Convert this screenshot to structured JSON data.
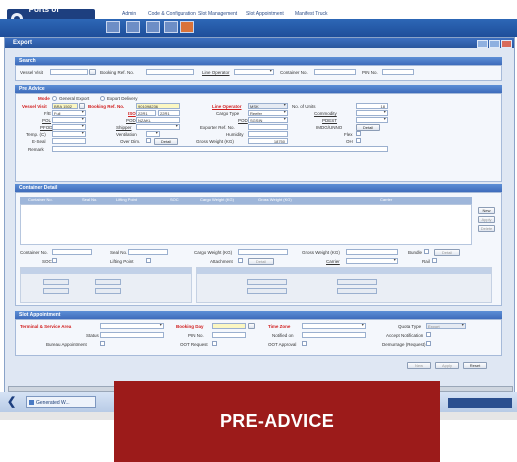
{
  "header": {
    "logo": "Ports of Auckland",
    "nav": [
      "Admin",
      "Code & Configuration",
      "Slot Management",
      "Slot Appointment",
      "Manifest Truck"
    ]
  },
  "window": {
    "title": "Export",
    "search": {
      "title": "Search",
      "vessel_visit": "Vessel Visit",
      "booking_ref": "Booking Ref. No.",
      "line_operator": "Line Operator",
      "container_no": "Container No.",
      "pin_no": "PIN No."
    },
    "preadvice": {
      "title": "Pre Advice",
      "mode_label": "Mode",
      "mode_general": "General Export",
      "mode_export_delivery": "Export Delivery",
      "vessel_visit_label": "Vessel Visit",
      "vessel_visit_value": "BRA 1502",
      "booking_label": "Booking Ref. No.",
      "booking_value": "901098236",
      "line_operator_label": "Line Operator",
      "line_operator_value": "MSK",
      "no_units_label": "No. of Units",
      "no_units_value": "18",
      "fe_label": "F/E",
      "fe_value": "Full",
      "iso_label": "ISO",
      "iso_value": "22R1",
      "iso_value2": "22R1",
      "cargo_type_label": "Cargo Type",
      "cargo_type_value": "Reefer",
      "commodity_label": "Commodity",
      "pol_label": "POL",
      "pol_value": "NZAKL",
      "pod_label": "POD",
      "pod_value": "SGSIN",
      "pod2_label": "PDEST",
      "pol2_label": "POD",
      "pfod_label": "PFOD",
      "shipper_label": "Shipper",
      "exporter_ref_label": "Exporter Ref. No.",
      "imdg_label": "IMDG/UNNO",
      "detail_btn": "Detail",
      "temp_label": "Temp. (C)",
      "ventilation_label": "Ventilation",
      "humidity_label": "Humidity",
      "flex_label": "Flex",
      "e_seal_label": "E-Seal",
      "over_dim_label": "Over Dim.",
      "gross_weight_label": "Gross Weight (KG)",
      "gross_weight_value": "18750",
      "oh_label": "OH",
      "remark_label": "Remark"
    },
    "container_detail": {
      "title": "Container Detail",
      "columns": [
        "Container No.",
        "Seal No.",
        "Lifting Point",
        "SOC",
        "Cargo Weight (KG)",
        "Gross Weight (KG)",
        "Carrier"
      ],
      "side_buttons": [
        "New",
        "Apply",
        "Delete"
      ],
      "container_no_label": "Container No.",
      "seal_label": "Seal No.",
      "cargo_weight_label": "Cargo Weight (KG)",
      "gross_weight_label": "Gross Weight (KG)",
      "bundle_label": "Bundle",
      "detail_btn": "Detail",
      "soc_label": "SOC",
      "lifting_label": "Lifting Point",
      "attachment_label": "Attachment",
      "carrier_label": "Carrier",
      "rail_label": "Rail"
    },
    "slot_appointment": {
      "title": "Slot Appointment",
      "terminal_label": "Terminal & Service Area",
      "booking_day_label": "Booking Day",
      "time_zone_label": "Time Zone",
      "quota_type_label": "Quota Type",
      "quota_type_value": "Export",
      "status_label": "Status",
      "pin_label": "PIN No.",
      "notified_label": "Notified on",
      "accept_label": "Accept Notification",
      "bureau_label": "Bureau Appointment",
      "oot_request_label": "OOT Request",
      "oot_approval_label": "OOT Approval",
      "demurrage_label": "Demurrage (Request)"
    },
    "footer_buttons": [
      "New",
      "Apply",
      "Reset"
    ]
  },
  "taskbar": {
    "item": "Generated W..."
  },
  "banner": {
    "text": "PRE-ADVICE"
  },
  "colors": {
    "banner": "#9c1b1a",
    "header_blue": "#2d67b6",
    "required_red": "#d11d1d"
  }
}
